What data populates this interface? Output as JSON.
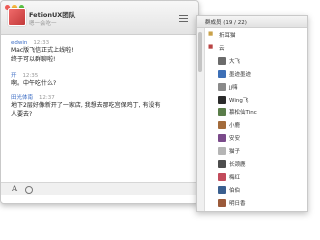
{
  "chat": {
    "group_name": "FetionUX团队",
    "group_sub": "嗯一会吃一",
    "messages": [
      {
        "sender": "edwin",
        "time": "12:33",
        "lines": [
          "Mac版飞信正式上线啦!",
          "终于可以群聊啦!"
        ]
      },
      {
        "sender": "开",
        "time": "12:35",
        "lines": [
          "啊。中午吃什么?"
        ]
      },
      {
        "sender": "田光体南",
        "time": "12:37",
        "lines": [
          "地下2层好像新开了一家店, 我想去那吃宫保鸡丁, 有没有",
          "人要去?"
        ]
      }
    ]
  },
  "panel": {
    "title": "群成员 (19 / 22)",
    "sections": [
      {
        "label": "折耳猫",
        "symbol": "■",
        "color": "#c9a14a"
      },
      {
        "label": "云",
        "symbol": "■",
        "color": "#b94444"
      }
    ],
    "members": [
      {
        "name": "大飞",
        "color": "#6b6b6b"
      },
      {
        "name": "墨迹墨迹",
        "color": "#3d6fb6"
      },
      {
        "name": "jj嗨",
        "color": "#8a8a8a"
      },
      {
        "name": "Wing飞",
        "color": "#2b2b2b"
      },
      {
        "name": "慕松仙Tinc",
        "color": "#5a7d4a"
      },
      {
        "name": "小鹿",
        "color": "#a36b3b"
      },
      {
        "name": "安安",
        "color": "#7a4a8a"
      },
      {
        "name": "猫子",
        "color": "#b5b5b5"
      },
      {
        "name": "长颈鹿",
        "color": "#4d4d4d"
      },
      {
        "name": "梅红",
        "color": "#c24b5b"
      },
      {
        "name": "伯伯",
        "color": "#3a5f8f"
      },
      {
        "name": "明日香",
        "color": "#9b5a3a"
      }
    ]
  },
  "colors": {
    "accent": "#3b6cc4",
    "close": "#ee5a55",
    "min": "#f5b63c",
    "max": "#5bc043"
  }
}
